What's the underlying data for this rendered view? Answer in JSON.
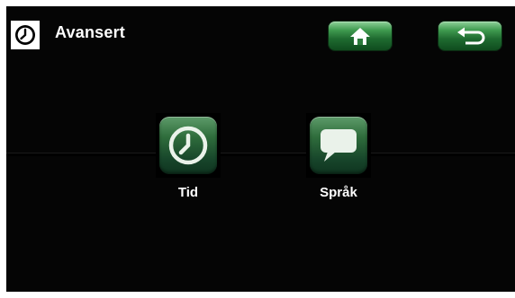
{
  "header": {
    "title": "Avansert",
    "icon": "clock-icon",
    "home_icon": "home-icon",
    "back_icon": "back-arrow-icon"
  },
  "menu": {
    "items": [
      {
        "label": "Tid",
        "icon": "clock-icon"
      },
      {
        "label": "Språk",
        "icon": "speech-bubble-icon"
      }
    ]
  },
  "colors": {
    "background": "#050505",
    "button_green": "#2f7d3f",
    "text": "#ffffff"
  }
}
